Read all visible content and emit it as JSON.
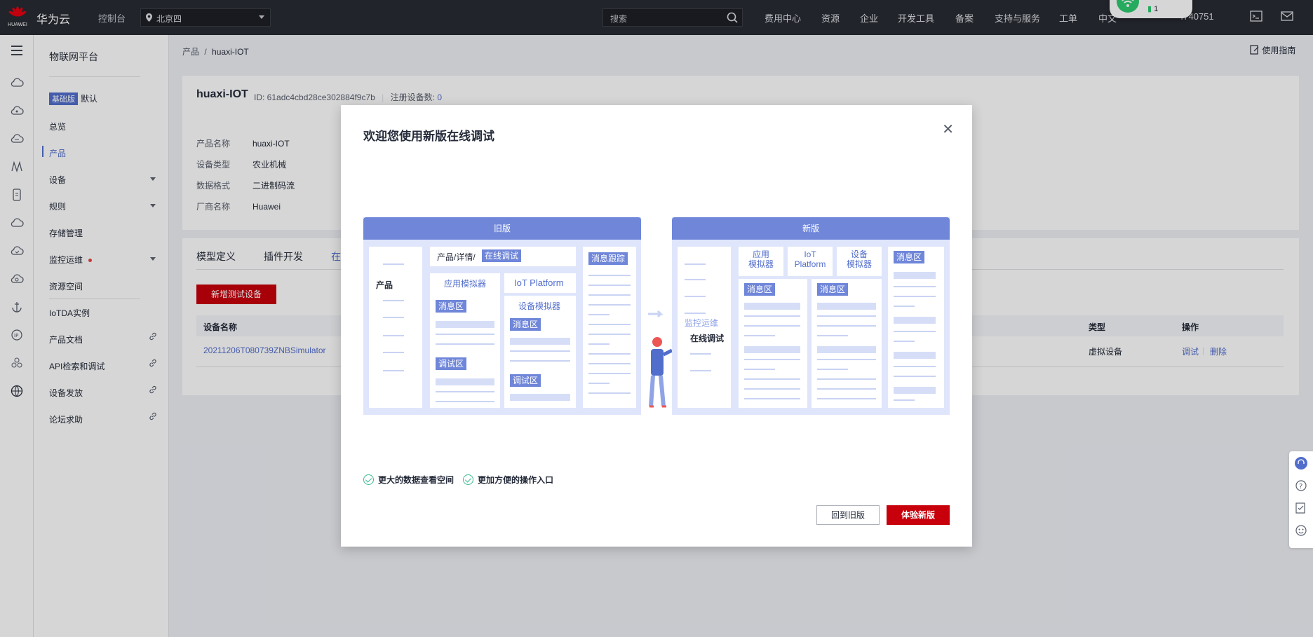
{
  "topbar": {
    "logo_text": "HUAWEI",
    "brand": "华为云",
    "console": "控制台",
    "region": "北京四",
    "search_placeholder": "搜索",
    "nav": [
      "费用中心",
      "资源",
      "企业",
      "开发工具",
      "备案",
      "支持与服务",
      "工单",
      "中文"
    ],
    "account": "4740751",
    "wifi_badge": "1",
    "icons": [
      "cloud-shell-icon",
      "mail-icon"
    ]
  },
  "sidebar": {
    "title": "物联网平台",
    "edition_badge": "基础版",
    "edition_value": "默认",
    "items": [
      "总览",
      "产品",
      "设备",
      "规则",
      "存储管理",
      "监控运维",
      "资源空间",
      "IoTDA实例",
      "产品文档",
      "API检索和调试",
      "设备发放",
      "论坛求助"
    ],
    "active": "产品"
  },
  "breadcrumb": {
    "root": "产品",
    "separator": "/",
    "current": "huaxi-IOT"
  },
  "guide_link": "使用指南",
  "product": {
    "name": "huaxi-IOT",
    "id_label": "ID: 61adc4cbd28ce302884f9c7b",
    "device_count_label": "注册设备数:",
    "device_count": "0",
    "fields": [
      {
        "k": "产品名称",
        "v": "huaxi-IOT"
      },
      {
        "k": "设备类型",
        "v": "农业机械"
      },
      {
        "k": "数据格式",
        "v": "二进制码流"
      },
      {
        "k": "厂商名称",
        "v": "Huawei"
      }
    ]
  },
  "tabs": [
    "模型定义",
    "插件开发",
    "在"
  ],
  "add_device_button": "新增测试设备",
  "table": {
    "headers": {
      "name": "设备名称",
      "type": "类型",
      "ops": "操作"
    },
    "rows": [
      {
        "name": "20211206T080739ZNBSimulator",
        "type": "虚拟设备",
        "op1": "调试",
        "op2": "删除"
      }
    ]
  },
  "modal": {
    "title": "欢迎您使用新版在线调试",
    "old": {
      "header": "旧版",
      "product": "产品",
      "breadcrumb": "产品/详情/",
      "online_debug": "在线调试",
      "msg_trace": "消息跟踪",
      "app_sim": "应用模拟器",
      "iot_platform": "IoT Platform",
      "device_sim": "设备模拟器",
      "msg_area": "消息区",
      "debug_area": "调试区"
    },
    "new": {
      "header": "新版",
      "monitor": "监控运维",
      "online_debug": "在线调试",
      "app_sim": "应用\n模拟器",
      "iot": "IoT\nPlatform",
      "dev_sim": "设备\n模拟器",
      "msg_area": "消息区"
    },
    "features": [
      "更大的数据查看空间",
      "更加方便的操作入口"
    ],
    "back_button": "回到旧版",
    "try_button": "体验新版"
  },
  "colors": {
    "brand_red": "#c7000b",
    "accent_blue": "#526ecc",
    "illus_blue": "#6f86d9",
    "topbar": "#282b33"
  }
}
